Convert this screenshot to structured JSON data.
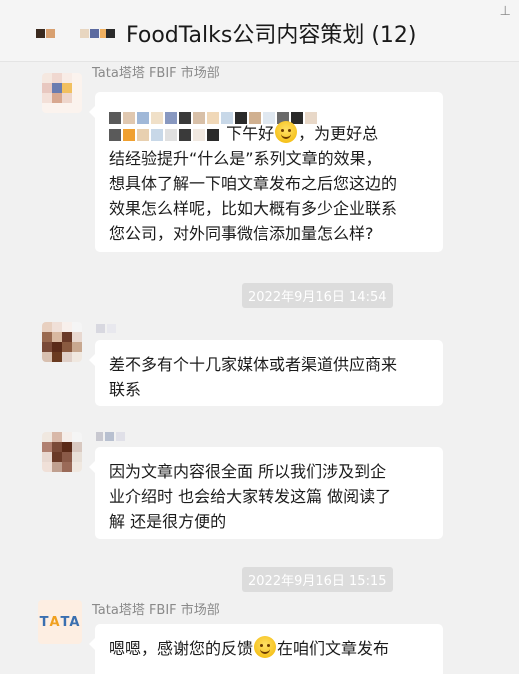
{
  "header": {
    "title": "FoodTalks公司内容策划 (12)",
    "pin_icon": "pin-icon"
  },
  "messages": [
    {
      "sender": "Tata塔塔 FBIF 市场部",
      "line1_suffix": "下午好",
      "line2": "结经验提升“什么是”系列文章的效果，",
      "line2_prefix": "，为更好总",
      "line3": "想具体了解一下咱文章发布之后您这边的",
      "line4": "效果怎么样呢，比如大概有多少企业联系",
      "line5": "您公司，对外同事微信添加量怎么样?"
    },
    {
      "line1": "差不多有个十几家媒体或者渠道供应商来",
      "line2": "联系"
    },
    {
      "line1": "因为文章内容很全面 所以我们涉及到企",
      "line2": "业介绍时 也会给大家转发这篇 做阅读了",
      "line3": "解 还是很方便的"
    },
    {
      "sender": "Tata塔塔 FBIF 市场部",
      "avatar_text_t": "T",
      "avatar_text_a": "A",
      "avatar_text_ta": "TA",
      "line1_a": "嗯嗯，感谢您的反馈",
      "line1_b": "在咱们文章发布"
    }
  ],
  "timestamps": [
    "2022年9月16日 14:54",
    "2022年9月16日 15:15"
  ],
  "colors": {
    "background": "#f1f1f1",
    "bubble": "#ffffff",
    "time_badge": "#dcdcdc"
  }
}
